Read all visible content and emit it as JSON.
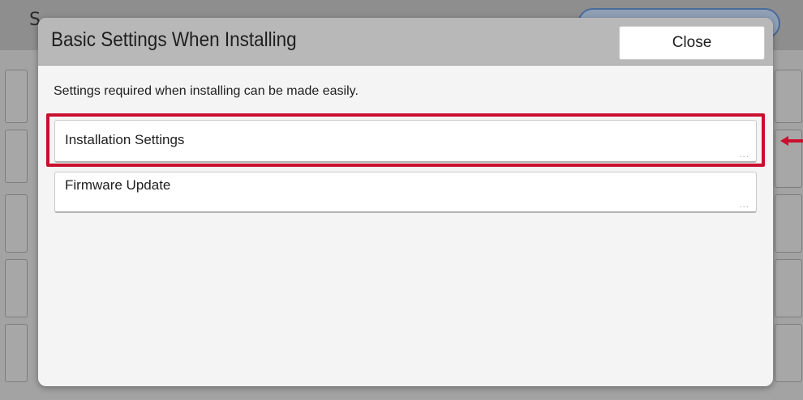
{
  "background": {
    "title": "S",
    "arrow_color": "#c8102e"
  },
  "modal": {
    "title": "Basic Settings When Installing",
    "close_label": "Close",
    "description": "Settings required when installing can be made easily.",
    "items": [
      {
        "label": "Installation Settings",
        "more": "...",
        "highlighted": true
      },
      {
        "label": "Firmware Update",
        "more": "...",
        "highlighted": false
      }
    ]
  },
  "colors": {
    "highlight": "#c8102e",
    "header": "#b8b8b8",
    "modal_body": "#f4f4f4"
  }
}
